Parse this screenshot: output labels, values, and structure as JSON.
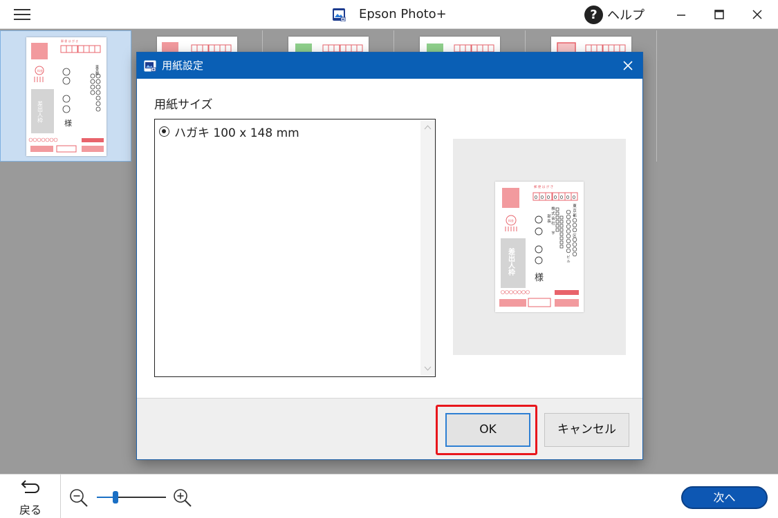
{
  "window": {
    "title": "Epson Photo+",
    "help_label": "ヘルプ",
    "menu_icon": "hamburger-menu-icon",
    "app_icon": "epson-photo-app-icon"
  },
  "thumbnails": [
    {
      "id": "postcard-1",
      "selected": true
    },
    {
      "id": "postcard-2",
      "selected": false
    },
    {
      "id": "postcard-3",
      "selected": false
    },
    {
      "id": "postcard-4",
      "selected": false
    },
    {
      "id": "postcard-5",
      "selected": false
    }
  ],
  "postcard_sample": {
    "postal_box_digits": "0000000",
    "recipient_honorific": "様",
    "sender_box_text": "差出人枠",
    "address_chars": "東京都○○○区○○○○○○ビル",
    "company_chars": "株式会社□□□□□□",
    "name_chars": "部長□□□□□□□",
    "sender_postal": "0000000",
    "colors": {
      "accent_red": "#e8636b",
      "stamp_pink": "#f29a9e",
      "gray_box": "#d4d4d4",
      "green_stamp": "#8fd08c"
    }
  },
  "dialog": {
    "title": "用紙設定",
    "section_label": "用紙サイズ",
    "paper_options": [
      {
        "label": "ハガキ 100 x 148 mm",
        "selected": true
      }
    ],
    "ok_label": "OK",
    "cancel_label": "キャンセル",
    "highlight_color": "#e8161c"
  },
  "bottom_bar": {
    "back_label": "戻る",
    "next_label": "次へ",
    "zoom_level": 0.27
  },
  "colors": {
    "dialog_header": "#0a5fb5",
    "next_button": "#0d57b3",
    "background": "#9a9a9a"
  }
}
